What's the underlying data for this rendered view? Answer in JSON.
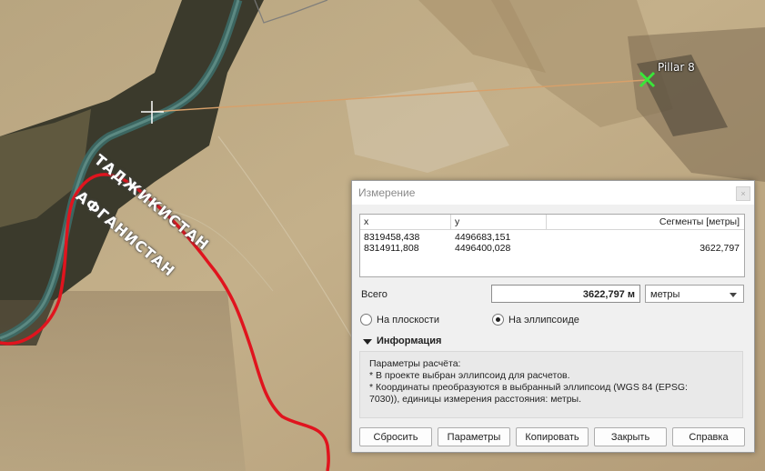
{
  "map": {
    "labels": {
      "tajikistan": "ТАДЖИКИСТАН",
      "afghanistan": "АФГАНИСТАН",
      "pillar": "Pillar 8"
    },
    "colors": {
      "border_line": "#e0141e",
      "measure_line": "#d8a06a",
      "pillar_marker": "#39e639",
      "river": "#3d6b67"
    }
  },
  "dialog": {
    "title": "Измерение",
    "close_glyph": "×",
    "table": {
      "headers": [
        "x",
        "y",
        "Сегменты [метры]"
      ],
      "rows": [
        {
          "x": "8319458,438",
          "y": "4496683,151",
          "segment": ""
        },
        {
          "x": "8314911,808",
          "y": "4496400,028",
          "segment": "3622,797"
        }
      ]
    },
    "total_label": "Всего",
    "total_value": "3622,797 м",
    "units_selected": "метры",
    "radio_flat": "На плоскости",
    "radio_ellipsoid": "На эллипсоиде",
    "radio_selected": "ellipsoid",
    "info_title": "Информация",
    "info_lines": [
      "Параметры расчёта:",
      "* В проекте выбран эллипсоид для расчетов.",
      "* Координаты преобразуются в выбранный эллипсоид (WGS 84 (EPSG:",
      "7030)), единицы измерения расстояния: метры."
    ],
    "buttons": {
      "reset": "Сбросить",
      "params": "Параметры",
      "copy": "Копировать",
      "close": "Закрыть",
      "help": "Справка"
    }
  }
}
